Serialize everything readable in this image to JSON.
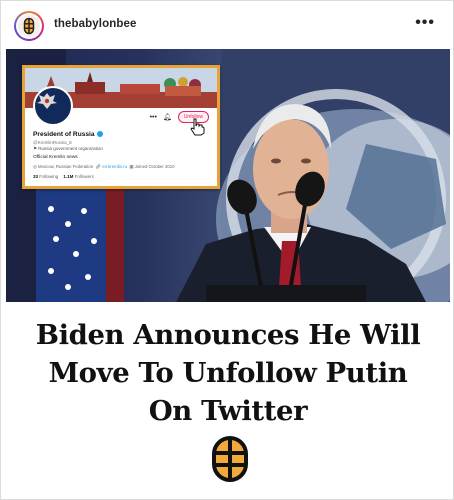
{
  "post": {
    "username": "thebabylonbee",
    "more_label": "•••"
  },
  "tweet_card": {
    "account_name": "President of Russia",
    "handle": "@KremlinRussia_E",
    "label": "Russia government organization",
    "bio": "Official Kremlin news",
    "location": "Moscow, Russian Federation",
    "website": "en.kremlin.ru",
    "joined": "Joined October 2010",
    "following_label": "Following",
    "followers_count": "1.1M",
    "followers_label": "Followers",
    "unfollow_label": "Unfollow"
  },
  "headline": {
    "line1": "Biden Announces He Will",
    "line2": "Move To Unfollow Putin",
    "line3": "On Twitter"
  },
  "colors": {
    "card_border": "#e6a33a",
    "unfollow": "#e0245e",
    "verified": "#1da1f2",
    "bee_yellow": "#f2a93b"
  }
}
